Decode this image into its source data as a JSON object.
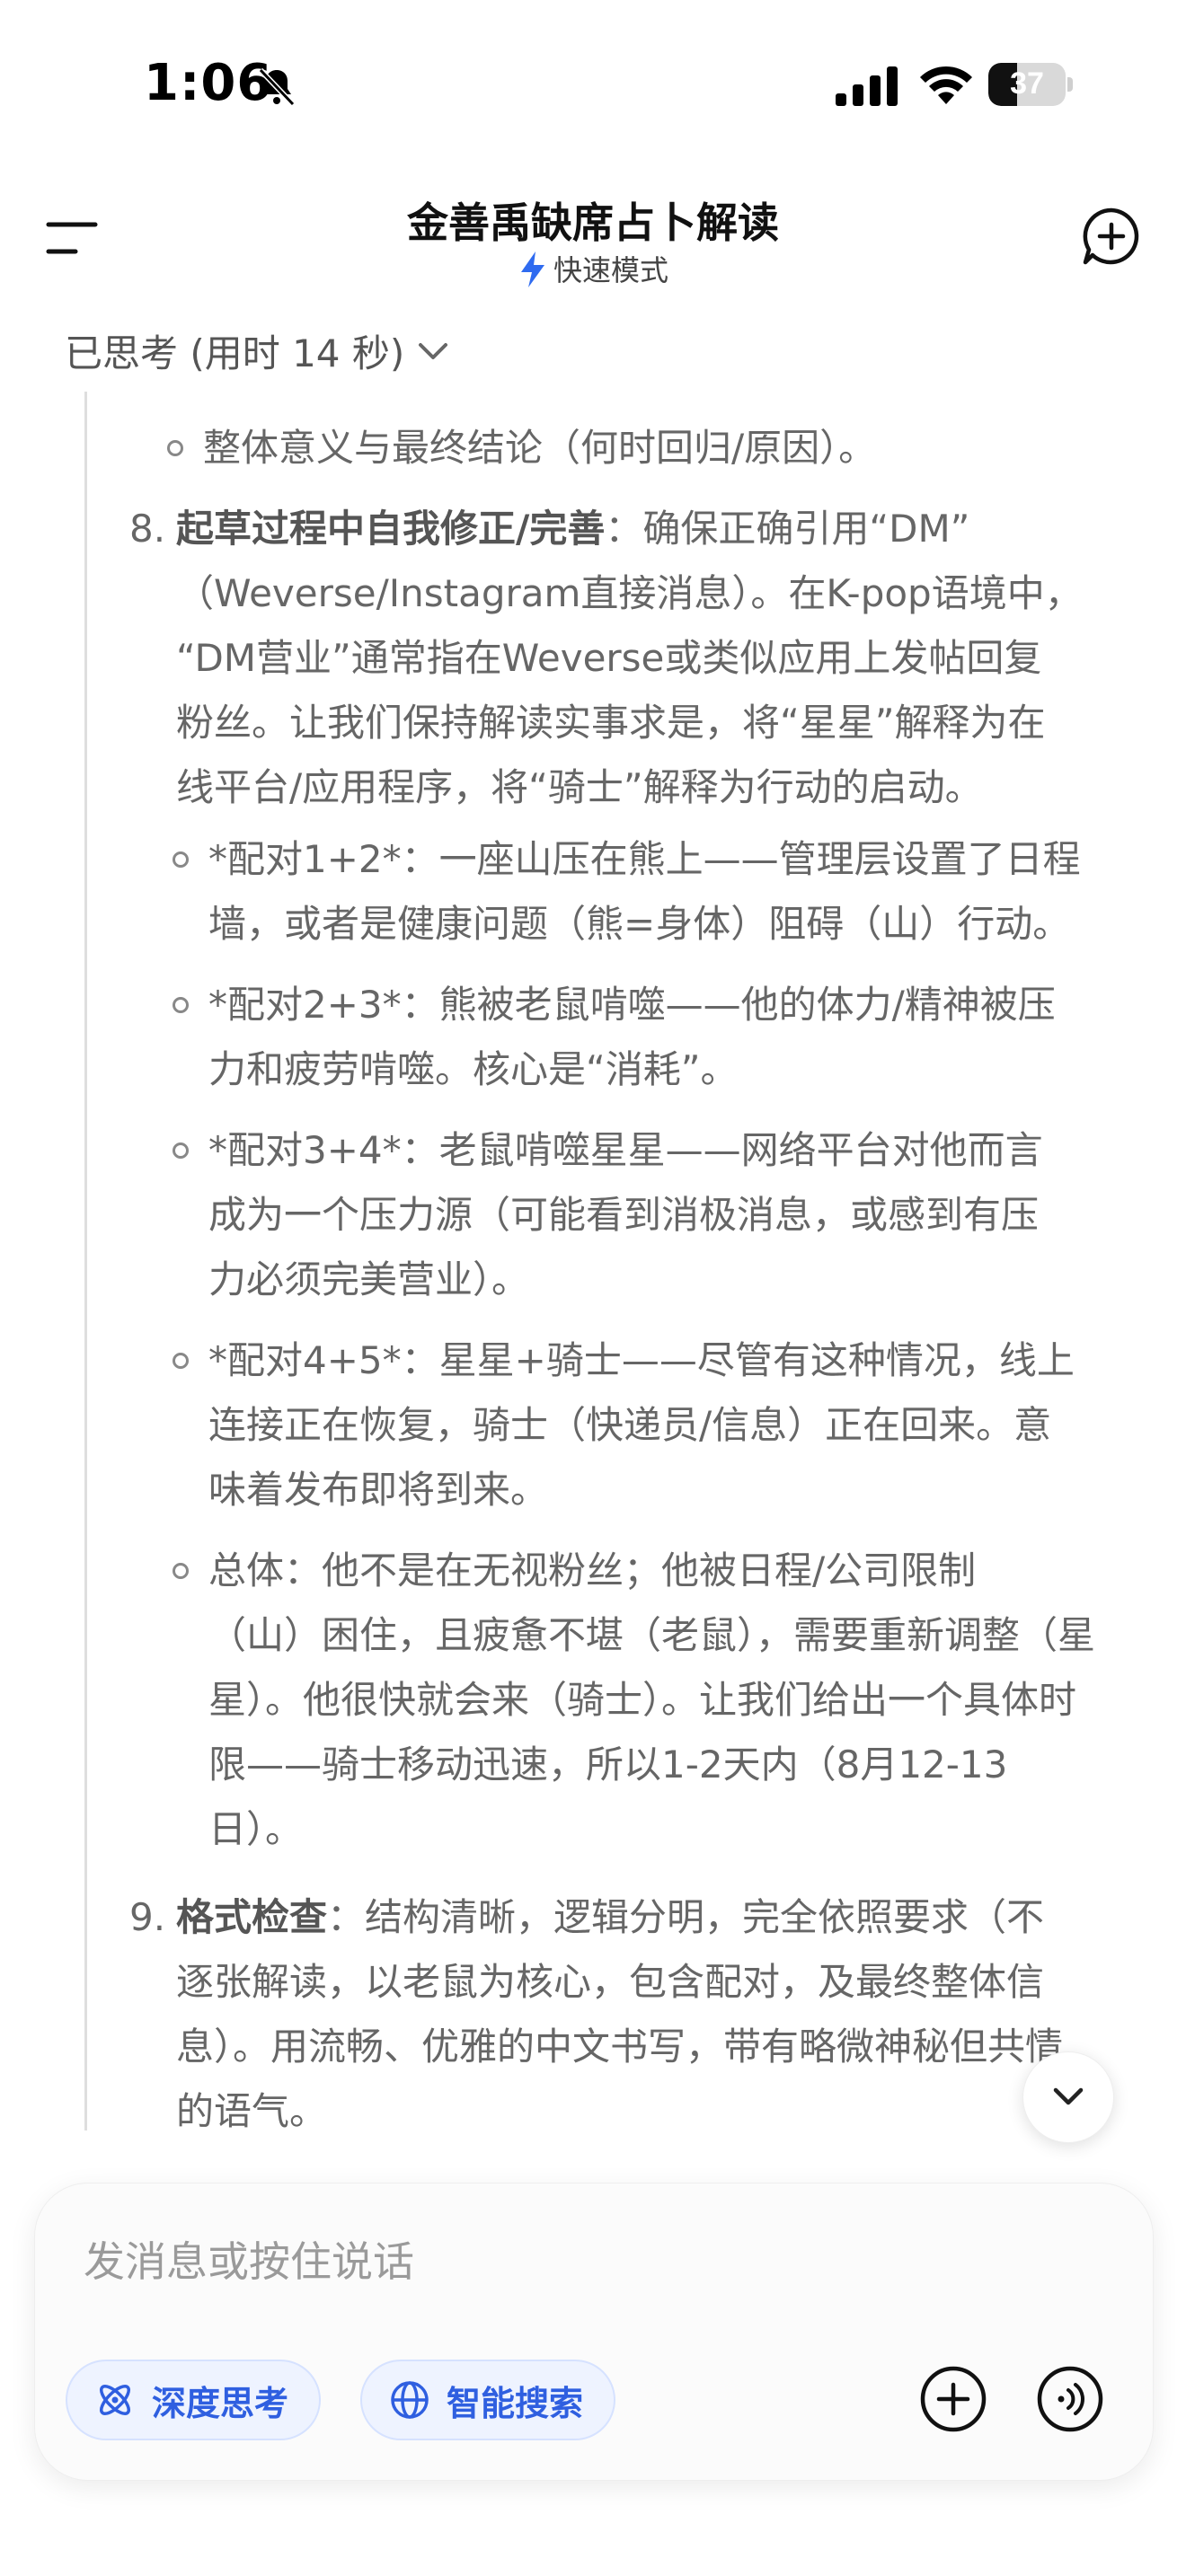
{
  "status_bar": {
    "time": "1:06",
    "battery_level": "37",
    "battery_fraction": 0.37
  },
  "header": {
    "title": "金善禹缺席占卜解读",
    "mode_label": "快速模式"
  },
  "thinking": {
    "header_label": "已思考 (用时 14 秒)",
    "top_bullet": "整体意义与最终结论（何时回归/原因）。",
    "item8": {
      "number": "8.",
      "bold_prefix": "起草过程中自我修正/完善",
      "lines": [
        "：确保正确引用“DM”",
        "（Weverse/Instagram直接消息）。在K-pop语境中，",
        "“DM营业”通常指在Weverse或类似应用上发帖回复",
        "粉丝。让我们保持解读实事求是，将“星星”解释为在",
        "线平台/应用程序，将“骑士”解释为行动的启动。"
      ],
      "bullets": [
        [
          "*配对1+2*：一座山压在熊上——管理层设置了日程",
          "墙，或者是健康问题（熊=身体）阻碍（山）行动。"
        ],
        [
          "*配对2+3*：熊被老鼠啃噬——他的体力/精神被压",
          "力和疲劳啃噬。核心是“消耗”。"
        ],
        [
          "*配对3+4*：老鼠啃噬星星——网络平台对他而言",
          "成为一个压力源（可能看到消极消息，或感到有压",
          "力必须完美营业）。"
        ],
        [
          "*配对4+5*：星星+骑士——尽管有这种情况，线上",
          "连接正在恢复，骑士（快递员/信息）正在回来。意",
          "味着发布即将到来。"
        ],
        [
          "总体：他不是在无视粉丝；他被日程/公司限制",
          "（山）困住，且疲惫不堪（老鼠），需要重新调整（星",
          "星）。他很快就会来（骑士）。让我们给出一个具体时",
          "限——骑士移动迅速，所以1-2天内（8月12-13",
          "日）。"
        ]
      ]
    },
    "item9": {
      "number": "9.",
      "bold_prefix": "格式检查",
      "lines": [
        "：结构清晰，逻辑分明，完全依照要求（不",
        "逐张解读，以老鼠为核心，包含配对，及最终整体信",
        "息）。用流畅、优雅的中文书写，带有略微神秘但共情",
        "的语气。"
      ]
    }
  },
  "composer": {
    "placeholder": "发消息或按住说话",
    "deep_think_label": "深度思考",
    "smart_search_label": "智能搜索"
  },
  "colors": {
    "accent": "#2f5fe0",
    "chip_bg": "#eef3ff",
    "text_muted": "#666666"
  }
}
